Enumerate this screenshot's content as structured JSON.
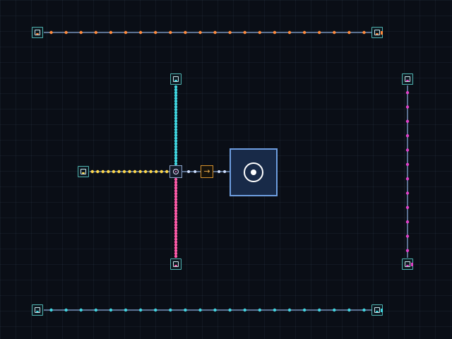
{
  "colors": {
    "background": "#0a0e16",
    "grid": "#1a2233",
    "node_border": "#4fb3b0",
    "belt": "#5a7090",
    "item_orange": "#ff8a3c",
    "item_cyan": "#3fd6e0",
    "item_yellow": "#ffd84a",
    "item_pink": "#ff5aa8",
    "item_magenta": "#e040c8",
    "hub_border": "#6e9ee0",
    "hub_fill": "#182a48",
    "arrow_box": "#d4902c"
  },
  "icons": {
    "extractor": "extractor-icon",
    "sink": "sink-icon",
    "merger": "merger-icon",
    "conveyor_arrow": "arrow-right-icon",
    "hub": "hub-target-icon",
    "item": "item-dot-icon"
  },
  "belts": [
    {
      "name": "top-belt",
      "item_color": "#ff8a3c",
      "direction": "right",
      "items": 22
    },
    {
      "name": "bottom-belt",
      "item_color": "#3fd6e0",
      "direction": "right",
      "items": 22
    },
    {
      "name": "vertical-cyan-belt",
      "item_color": "#3fd6e0",
      "direction": "down",
      "items": 28
    },
    {
      "name": "vertical-pink-belt",
      "item_color": "#ff5aa8",
      "direction": "up",
      "items": 28
    },
    {
      "name": "yellow-belt",
      "item_color": "#ffd84a",
      "direction": "right",
      "items": 15
    },
    {
      "name": "right-magenta-belt",
      "item_color": "#e040c8",
      "direction": "down",
      "items": 12
    }
  ],
  "hub": {
    "symbol": "target"
  }
}
